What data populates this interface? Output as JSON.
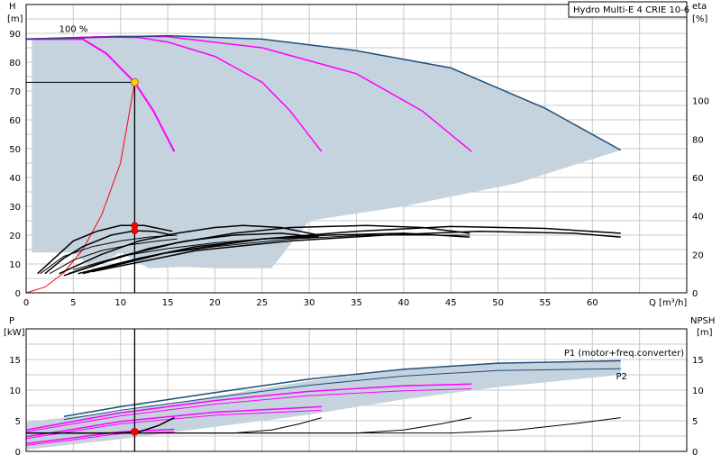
{
  "window": {
    "title": "Hydro Multi-E 4 CRIE 10-6"
  },
  "colors": {
    "envelope_fill": "#c5d3df",
    "envelope_edge": "#1f4e7a",
    "magenta": "#ff00ff",
    "black": "#000000",
    "red": "#ff0000",
    "duty_point": "#ffd200"
  },
  "chart_data": [
    {
      "id": "head",
      "type": "line",
      "title": "Hydro Multi-E 4 CRIE 10-6",
      "xlabel": "Q [m³/h]",
      "ylabel_top": "H",
      "ylabel_unit": "[m]",
      "y2label_top": "eta",
      "y2label_unit": "[%]",
      "xlim": [
        0,
        70
      ],
      "ylim": [
        0,
        100
      ],
      "y2lim": [
        0,
        150
      ],
      "x_ticks": [
        "0",
        "5",
        "10",
        "15",
        "20",
        "25",
        "30",
        "35",
        "40",
        "45",
        "50",
        "55",
        "60"
      ],
      "y_ticks": [
        "0",
        "10",
        "20",
        "30",
        "40",
        "50",
        "60",
        "70",
        "80",
        "90"
      ],
      "y2_ticks": [
        "0",
        "20",
        "40",
        "60",
        "80",
        "100"
      ],
      "annotations": [
        {
          "text": "100 %",
          "x": 3.5,
          "y": 90.5
        }
      ],
      "grid": true,
      "envelope": [
        [
          0.6,
          88
        ],
        [
          15,
          89.2
        ],
        [
          25,
          88
        ],
        [
          35,
          84
        ],
        [
          45,
          78
        ],
        [
          55,
          64
        ],
        [
          63,
          49.5
        ],
        [
          52,
          38
        ],
        [
          40,
          30
        ],
        [
          30,
          25
        ],
        [
          26,
          8.5
        ],
        [
          20,
          8.5
        ],
        [
          17,
          9
        ],
        [
          13,
          8.5
        ],
        [
          10,
          14
        ],
        [
          7,
          8.5
        ],
        [
          5,
          14
        ],
        [
          0.6,
          14
        ]
      ],
      "series": [
        {
          "role": "head",
          "color": "#ff00ff",
          "width": 2,
          "points": [
            [
              0,
              88
            ],
            [
              6,
              88
            ],
            [
              8.5,
              83
            ],
            [
              10,
              78
            ],
            [
              11.5,
              73
            ],
            [
              13.5,
              63
            ],
            [
              15.7,
              49
            ]
          ]
        },
        {
          "role": "head",
          "color": "#ff00ff",
          "width": 1.5,
          "points": [
            [
              0,
              88
            ],
            [
              8,
              88.8
            ],
            [
              12,
              88.5
            ],
            [
              15,
              87
            ],
            [
              20,
              82
            ],
            [
              25,
              73
            ],
            [
              28,
              63
            ],
            [
              31.3,
              49
            ]
          ]
        },
        {
          "role": "head",
          "color": "#ff00ff",
          "width": 1.5,
          "points": [
            [
              0,
              88
            ],
            [
              10,
              89
            ],
            [
              15,
              88.8
            ],
            [
              25,
              85
            ],
            [
              35,
              76
            ],
            [
              42,
              63
            ],
            [
              47.2,
              49
            ]
          ]
        },
        {
          "role": "head",
          "color": "#1f4e7a",
          "width": 1.5,
          "points": [
            [
              0,
              88
            ],
            [
              15,
              89.2
            ],
            [
              25,
              88
            ],
            [
              35,
              84
            ],
            [
              45,
              78
            ],
            [
              55,
              64
            ],
            [
              63,
              49.5
            ]
          ]
        },
        {
          "role": "system",
          "color": "#ff0000",
          "width": 1,
          "points": [
            [
              0,
              0
            ],
            [
              2,
              2
            ],
            [
              4,
              7
            ],
            [
              6,
              15
            ],
            [
              8,
              27
            ],
            [
              10,
              45
            ],
            [
              11.5,
              73
            ]
          ]
        },
        {
          "role": "efficiency",
          "color": "#000000",
          "width": 1.5,
          "points": [
            [
              1.2,
              10
            ],
            [
              3,
              18
            ],
            [
              5,
              27
            ],
            [
              7.5,
              32
            ],
            [
              10,
              35
            ],
            [
              12.5,
              35
            ],
            [
              15.5,
              32
            ]
          ]
        },
        {
          "role": "efficiency",
          "color": "#000000",
          "width": 1.5,
          "points": [
            [
              2,
              10
            ],
            [
              4,
              18
            ],
            [
              6,
              24
            ],
            [
              9,
              30
            ],
            [
              11.5,
              32.3
            ],
            [
              13.5,
              32
            ],
            [
              15.5,
              30
            ]
          ]
        },
        {
          "role": "efficiency",
          "color": "#000000",
          "width": 1,
          "points": [
            [
              1.5,
              10
            ],
            [
              4,
              19
            ],
            [
              7,
              24
            ],
            [
              10,
              27
            ],
            [
              13,
              29
            ],
            [
              16,
              30
            ]
          ]
        },
        {
          "role": "efficiency",
          "color": "#000000",
          "width": 1,
          "points": [
            [
              2.5,
              10
            ],
            [
              5,
              17
            ],
            [
              8,
              22
            ],
            [
              11,
              25
            ],
            [
              14,
              27
            ],
            [
              16,
              28
            ]
          ]
        },
        {
          "role": "efficiency",
          "color": "#000000",
          "width": 1.5,
          "points": [
            [
              3.5,
              10
            ],
            [
              8,
              20
            ],
            [
              12,
              27
            ],
            [
              16,
              31
            ],
            [
              20,
              34
            ],
            [
              23,
              35
            ],
            [
              27,
              34
            ],
            [
              31,
              30
            ]
          ]
        },
        {
          "role": "efficiency",
          "color": "#000000",
          "width": 1.5,
          "points": [
            [
              4,
              9
            ],
            [
              9,
              17
            ],
            [
              13,
              23
            ],
            [
              17,
              27
            ],
            [
              22,
              30
            ],
            [
              27,
              31
            ],
            [
              31,
              29
            ]
          ]
        },
        {
          "role": "efficiency",
          "color": "#000000",
          "width": 1,
          "points": [
            [
              5,
              12
            ],
            [
              10,
              19
            ],
            [
              15,
              23
            ],
            [
              20,
              26
            ],
            [
              25,
              28
            ],
            [
              31,
              29
            ]
          ]
        },
        {
          "role": "efficiency",
          "color": "#000000",
          "width": 1.5,
          "points": [
            [
              4.5,
              10
            ],
            [
              10,
              19
            ],
            [
              16,
              26
            ],
            [
              22,
              31
            ],
            [
              28,
              34
            ],
            [
              36,
              35
            ],
            [
              42,
              34
            ],
            [
              47,
              31
            ]
          ]
        },
        {
          "role": "efficiency",
          "color": "#000000",
          "width": 1.5,
          "points": [
            [
              5.5,
              10
            ],
            [
              12,
              18
            ],
            [
              18,
              24
            ],
            [
              25,
              28
            ],
            [
              32,
              30
            ],
            [
              40,
              31
            ],
            [
              47,
              29
            ]
          ]
        },
        {
          "role": "efficiency",
          "color": "#000000",
          "width": 1,
          "points": [
            [
              7,
              12
            ],
            [
              14,
              20
            ],
            [
              20,
              24
            ],
            [
              28,
              28
            ],
            [
              36,
              30
            ],
            [
              47,
              30
            ]
          ]
        },
        {
          "role": "efficiency",
          "color": "#000000",
          "width": 1.5,
          "points": [
            [
              6,
              10
            ],
            [
              15,
              21
            ],
            [
              25,
              28
            ],
            [
              35,
              32
            ],
            [
              45,
              34.5
            ],
            [
              55,
              33.5
            ],
            [
              63,
              31
            ]
          ]
        },
        {
          "role": "efficiency",
          "color": "#000000",
          "width": 1.5,
          "points": [
            [
              7,
              11
            ],
            [
              18,
              22
            ],
            [
              28,
              27
            ],
            [
              38,
              30
            ],
            [
              48,
              32
            ],
            [
              58,
              31
            ],
            [
              63,
              29
            ]
          ]
        }
      ],
      "duty_point": {
        "x": 11.5,
        "y": 73,
        "eta_points": [
          35,
          32.3
        ]
      }
    },
    {
      "id": "power",
      "type": "line",
      "ylabel_top": "P",
      "ylabel_unit": "[kW]",
      "y2label_top": "NPSH",
      "y2label_unit": "[m]",
      "xlim": [
        0,
        70
      ],
      "ylim": [
        0,
        20
      ],
      "y2lim": [
        0,
        20
      ],
      "y_ticks": [
        "0",
        "5",
        "10",
        "15"
      ],
      "y2_ticks": [
        "0",
        "5",
        "10",
        "15"
      ],
      "labels": [
        {
          "text": "P1 (motor+freq.converter)",
          "x": 57,
          "y": 15.6
        },
        {
          "text": "P2",
          "x": 62.5,
          "y": 11.8
        }
      ],
      "grid": true,
      "envelope": [
        [
          0,
          4.8
        ],
        [
          10,
          6.5
        ],
        [
          20,
          9
        ],
        [
          30,
          11.5
        ],
        [
          40,
          13.3
        ],
        [
          50,
          14.3
        ],
        [
          63,
          14.9
        ],
        [
          63,
          12.5
        ],
        [
          50,
          10.5
        ],
        [
          40,
          8.5
        ],
        [
          30,
          6
        ],
        [
          20,
          4
        ],
        [
          10,
          2
        ],
        [
          0,
          0.3
        ]
      ],
      "series": [
        {
          "role": "P1",
          "color": "#1f4e7a",
          "width": 1.5,
          "points": [
            [
              4,
              5.7
            ],
            [
              10,
              7.3
            ],
            [
              20,
              9.6
            ],
            [
              30,
              11.8
            ],
            [
              40,
              13.4
            ],
            [
              50,
              14.4
            ],
            [
              63,
              14.8
            ]
          ]
        },
        {
          "role": "P2",
          "color": "#1f4e7a",
          "width": 1,
          "points": [
            [
              4,
              5.2
            ],
            [
              10,
              6.7
            ],
            [
              20,
              8.8
            ],
            [
              30,
              10.8
            ],
            [
              40,
              12.3
            ],
            [
              50,
              13.2
            ],
            [
              63,
              13.5
            ]
          ]
        },
        {
          "role": "P1",
          "color": "#ff00ff",
          "width": 1.5,
          "points": [
            [
              0,
              1.3
            ],
            [
              5,
              2.2
            ],
            [
              10,
              3.2
            ],
            [
              15.7,
              3.6
            ]
          ]
        },
        {
          "role": "P1",
          "color": "#ff00ff",
          "width": 1.5,
          "points": [
            [
              0,
              2.4
            ],
            [
              5,
              3.6
            ],
            [
              10,
              4.9
            ],
            [
              20,
              6.4
            ],
            [
              31.3,
              7.3
            ]
          ]
        },
        {
          "role": "P1",
          "color": "#ff00ff",
          "width": 1.5,
          "points": [
            [
              0,
              3.5
            ],
            [
              10,
              6.3
            ],
            [
              20,
              8.3
            ],
            [
              30,
              9.8
            ],
            [
              40,
              10.7
            ],
            [
              47.2,
              11
            ]
          ]
        },
        {
          "role": "P2",
          "color": "#ff00ff",
          "width": 1,
          "points": [
            [
              0,
              1
            ],
            [
              5,
              1.9
            ],
            [
              10,
              2.9
            ],
            [
              15.7,
              3.2
            ]
          ]
        },
        {
          "role": "P2",
          "color": "#ff00ff",
          "width": 1,
          "points": [
            [
              0,
              2.1
            ],
            [
              5,
              3.3
            ],
            [
              10,
              4.5
            ],
            [
              20,
              5.9
            ],
            [
              31.3,
              6.7
            ]
          ]
        },
        {
          "role": "P2",
          "color": "#ff00ff",
          "width": 1,
          "points": [
            [
              0,
              3.2
            ],
            [
              10,
              5.8
            ],
            [
              20,
              7.7
            ],
            [
              30,
              9.1
            ],
            [
              40,
              9.9
            ],
            [
              47.2,
              10.2
            ]
          ]
        },
        {
          "role": "NPSH",
          "color": "#000000",
          "width": 1.5,
          "points": [
            [
              0,
              3
            ],
            [
              10,
              3
            ],
            [
              12,
              3.2
            ],
            [
              14,
              4.2
            ],
            [
              15.7,
              5.5
            ]
          ]
        },
        {
          "role": "NPSH",
          "color": "#000000",
          "width": 1,
          "points": [
            [
              0,
              3
            ],
            [
              22,
              3
            ],
            [
              26,
              3.5
            ],
            [
              29,
              4.5
            ],
            [
              31.3,
              5.5
            ]
          ]
        },
        {
          "role": "NPSH",
          "color": "#000000",
          "width": 1,
          "points": [
            [
              0,
              3
            ],
            [
              35,
              3
            ],
            [
              40,
              3.5
            ],
            [
              44,
              4.5
            ],
            [
              47.2,
              5.5
            ]
          ]
        },
        {
          "role": "NPSH",
          "color": "#000000",
          "width": 1,
          "points": [
            [
              0,
              3
            ],
            [
              45,
              3
            ],
            [
              52,
              3.5
            ],
            [
              58,
              4.5
            ],
            [
              63,
              5.5
            ]
          ]
        }
      ],
      "duty_point": {
        "x": 11.5,
        "y": 3.2
      }
    }
  ]
}
